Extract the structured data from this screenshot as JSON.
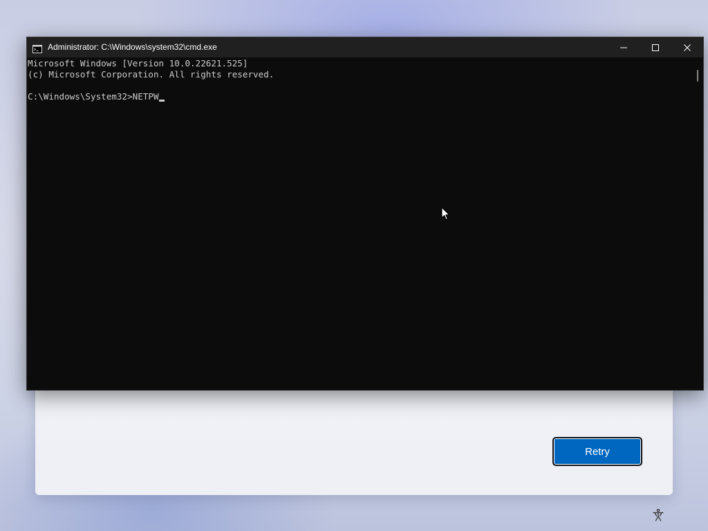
{
  "window": {
    "title": "Administrator: C:\\Windows\\system32\\cmd.exe",
    "icon": "console-app-icon",
    "controls": {
      "minimize_icon": "minimize-icon",
      "maximize_icon": "maximize-icon",
      "close_icon": "close-icon"
    }
  },
  "console": {
    "lines": [
      "Microsoft Windows [Version 10.0.22621.525]",
      "(c) Microsoft Corporation. All rights reserved.",
      "",
      "C:\\Windows\\System32>NETPW"
    ],
    "colors": {
      "background": "#0c0c0c",
      "text": "#cccccc"
    }
  },
  "oobe": {
    "retry_label": "Retry",
    "accent": "#0067c0",
    "accessibility_icon": "accessibility-icon"
  }
}
